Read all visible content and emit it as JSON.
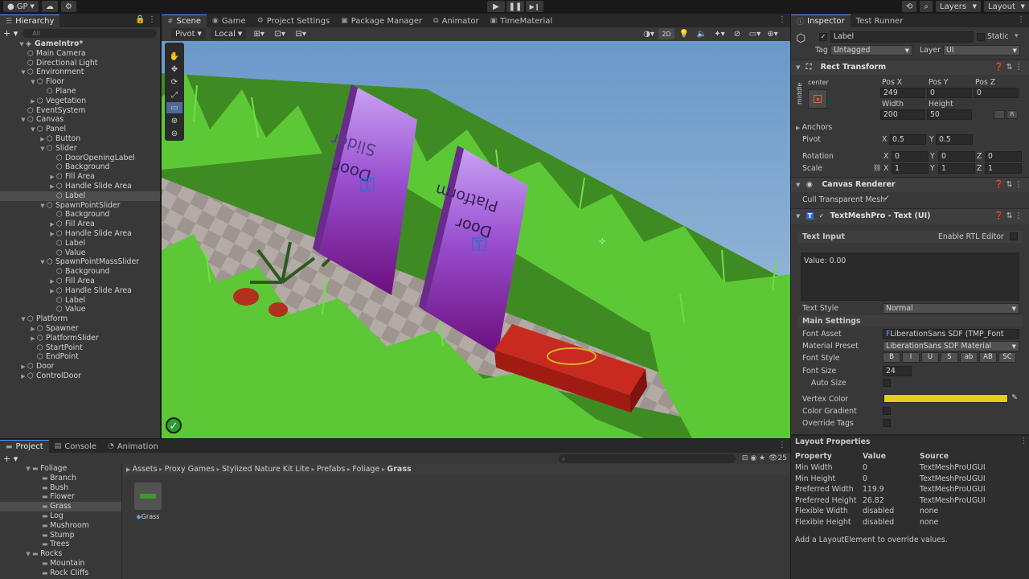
{
  "toolbar": {
    "account": "GP",
    "layers": "Layers",
    "layout": "Layout"
  },
  "hierarchy": {
    "tab": "Hierarchy",
    "search_placeholder": "All",
    "items": [
      {
        "label": "GameIntro*",
        "depth": 0,
        "arrow": "▼",
        "bold": true
      },
      {
        "label": "Main Camera",
        "depth": 1,
        "arrow": ""
      },
      {
        "label": "Directional Light",
        "depth": 1,
        "arrow": ""
      },
      {
        "label": "Environment",
        "depth": 1,
        "arrow": "▼"
      },
      {
        "label": "Floor",
        "depth": 2,
        "arrow": "▼"
      },
      {
        "label": "Plane",
        "depth": 3,
        "arrow": ""
      },
      {
        "label": "Vegetation",
        "depth": 2,
        "arrow": "▶"
      },
      {
        "label": "EventSystem",
        "depth": 1,
        "arrow": ""
      },
      {
        "label": "Canvas",
        "depth": 1,
        "arrow": "▼"
      },
      {
        "label": "Panel",
        "depth": 2,
        "arrow": "▼"
      },
      {
        "label": "Button",
        "depth": 3,
        "arrow": "▶"
      },
      {
        "label": "Slider",
        "depth": 3,
        "arrow": "▼"
      },
      {
        "label": "DoorOpeningLabel",
        "depth": 4,
        "arrow": ""
      },
      {
        "label": "Background",
        "depth": 4,
        "arrow": ""
      },
      {
        "label": "Fill Area",
        "depth": 4,
        "arrow": "▶"
      },
      {
        "label": "Handle Slide Area",
        "depth": 4,
        "arrow": "▶"
      },
      {
        "label": "Label",
        "depth": 4,
        "arrow": "",
        "selected": true
      },
      {
        "label": "SpawnPointSlider",
        "depth": 3,
        "arrow": "▼"
      },
      {
        "label": "Background",
        "depth": 4,
        "arrow": ""
      },
      {
        "label": "Fill Area",
        "depth": 4,
        "arrow": "▶"
      },
      {
        "label": "Handle Slide Area",
        "depth": 4,
        "arrow": "▶"
      },
      {
        "label": "Label",
        "depth": 4,
        "arrow": ""
      },
      {
        "label": "Value",
        "depth": 4,
        "arrow": ""
      },
      {
        "label": "SpawnPointMassSlider",
        "depth": 3,
        "arrow": "▼"
      },
      {
        "label": "Background",
        "depth": 4,
        "arrow": ""
      },
      {
        "label": "Fill Area",
        "depth": 4,
        "arrow": "▶"
      },
      {
        "label": "Handle Slide Area",
        "depth": 4,
        "arrow": "▶"
      },
      {
        "label": "Label",
        "depth": 4,
        "arrow": ""
      },
      {
        "label": "Value",
        "depth": 4,
        "arrow": ""
      },
      {
        "label": "Platform",
        "depth": 1,
        "arrow": "▼"
      },
      {
        "label": "Spawner",
        "depth": 2,
        "arrow": "▶"
      },
      {
        "label": "PlatformSlider",
        "depth": 2,
        "arrow": "▶"
      },
      {
        "label": "StartPoint",
        "depth": 2,
        "arrow": ""
      },
      {
        "label": "EndPoint",
        "depth": 2,
        "arrow": ""
      },
      {
        "label": "Door",
        "depth": 1,
        "arrow": "▶"
      },
      {
        "label": "ControlDoor",
        "depth": 1,
        "arrow": "▶"
      }
    ]
  },
  "center_tabs": [
    "Scene",
    "Game",
    "Project Settings",
    "Package Manager",
    "Animator",
    "TimeMaterial"
  ],
  "scene_toolbar": {
    "pivot": "Pivot",
    "local": "Local",
    "mode_2d": "2D"
  },
  "scene_text": {
    "slider_board": [
      "Slider",
      "Door"
    ],
    "platform_board": [
      "Platform",
      "Door"
    ],
    "tmp_glyph": "T"
  },
  "inspector": {
    "tabs": [
      "Inspector",
      "Test Runner"
    ],
    "object_name": "Label",
    "static_label": "Static",
    "tag_label": "Tag",
    "tag_value": "Untagged",
    "layer_label": "Layer",
    "layer_value": "UI",
    "rect_transform": {
      "title": "Rect Transform",
      "anchor_h": "center",
      "anchor_v": "middle",
      "posx_label": "Pos X",
      "posy_label": "Pos Y",
      "posz_label": "Pos Z",
      "posx": "249",
      "posy": "0",
      "posz": "0",
      "width_label": "Width",
      "height_label": "Height",
      "width": "200",
      "height": "50",
      "raw_btn": "R",
      "anchors": "Anchors",
      "pivot": "Pivot",
      "pivot_x": "0.5",
      "pivot_y": "0.5",
      "rotation": "Rotation",
      "rot_x": "0",
      "rot_y": "0",
      "rot_z": "0",
      "scale": "Scale",
      "scale_x": "1",
      "scale_y": "1",
      "scale_z": "1",
      "x": "X",
      "y": "Y",
      "z": "Z"
    },
    "canvas_renderer": {
      "title": "Canvas Renderer",
      "cull": "Cull Transparent Mesh"
    },
    "tmp": {
      "title": "TextMeshPro - Text (UI)",
      "text_input": "Text Input",
      "rtl": "Enable RTL Editor",
      "text_value": "Value: 0.00",
      "text_style_label": "Text Style",
      "text_style_value": "Normal",
      "main_settings": "Main Settings",
      "font_asset_label": "Font Asset",
      "font_asset_value": "LiberationSans SDF (TMP_Font As:",
      "material_preset_label": "Material Preset",
      "material_preset_value": "LiberationSans SDF Material",
      "font_style_label": "Font Style",
      "font_style_buttons": [
        "B",
        "I",
        "U",
        "S",
        "ab",
        "AB",
        "SC"
      ],
      "font_size_label": "Font Size",
      "font_size_value": "24",
      "auto_size": "Auto Size",
      "vertex_color_label": "Vertex Color",
      "vertex_color": "#e1cf1e",
      "color_gradient": "Color Gradient",
      "override_tags": "Override Tags"
    }
  },
  "layout_properties": {
    "title": "Layout Properties",
    "headers": [
      "Property",
      "Value",
      "Source"
    ],
    "rows": [
      [
        "Min Width",
        "0",
        "TextMeshProUGUI"
      ],
      [
        "Min Height",
        "0",
        "TextMeshProUGUI"
      ],
      [
        "Preferred Width",
        "119.9",
        "TextMeshProUGUI"
      ],
      [
        "Preferred Height",
        "26.82",
        "TextMeshProUGUI"
      ],
      [
        "Flexible Width",
        "disabled",
        "none"
      ],
      [
        "Flexible Height",
        "disabled",
        "none"
      ]
    ],
    "footer": "Add a LayoutElement to override values."
  },
  "project": {
    "tabs": [
      "Project",
      "Console",
      "Animation"
    ],
    "tree": [
      {
        "label": "Foliage",
        "depth": 0,
        "arrow": "▼",
        "folder": true
      },
      {
        "label": "Branch",
        "depth": 1,
        "folder": true
      },
      {
        "label": "Bush",
        "depth": 1,
        "folder": true
      },
      {
        "label": "Flower",
        "depth": 1,
        "folder": true
      },
      {
        "label": "Grass",
        "depth": 1,
        "folder": true,
        "selected": true
      },
      {
        "label": "Log",
        "depth": 1,
        "folder": true
      },
      {
        "label": "Mushroom",
        "depth": 1,
        "folder": true
      },
      {
        "label": "Stump",
        "depth": 1,
        "folder": true
      },
      {
        "label": "Trees",
        "depth": 1,
        "folder": true
      },
      {
        "label": "Rocks",
        "depth": 0,
        "arrow": "▼",
        "folder": true
      },
      {
        "label": "Mountain",
        "depth": 1,
        "folder": true
      },
      {
        "label": "Rock Cliffs",
        "depth": 1,
        "folder": true
      }
    ],
    "breadcrumb": [
      "Assets",
      "Proxy Games",
      "Stylized Nature Kit Lite",
      "Prefabs",
      "Foliage",
      "Grass"
    ],
    "asset_label": "Grass",
    "hidden_count": "25"
  },
  "colors": {
    "accent": "#4a8cf7",
    "purple": "#7a1a8c",
    "grass": "#4bb82a",
    "sky": "#8ab2d4",
    "platform_red": "#c92a1f"
  }
}
